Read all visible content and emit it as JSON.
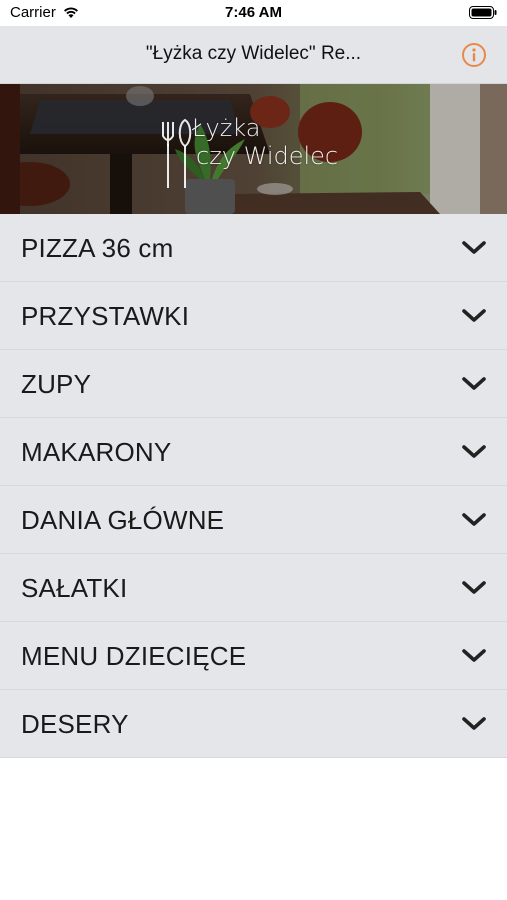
{
  "status_bar": {
    "carrier": "Carrier",
    "time": "7:46 AM"
  },
  "nav": {
    "title": "\"Łyżka czy Widelec\" Re...",
    "info_icon": "info-icon",
    "accent_color": "#e8894a"
  },
  "hero": {
    "logo_line1": "Łyżka",
    "logo_line2": "czy Widelec"
  },
  "menu": {
    "items": [
      {
        "label": "PIZZA 36 cm"
      },
      {
        "label": "PRZYSTAWKI"
      },
      {
        "label": "ZUPY"
      },
      {
        "label": "MAKARONY"
      },
      {
        "label": "DANIA GŁÓWNE"
      },
      {
        "label": "SAŁATKI"
      },
      {
        "label": "MENU DZIECIĘCE"
      },
      {
        "label": "DESERY"
      }
    ],
    "chevron_icon": "chevron-down-icon"
  }
}
